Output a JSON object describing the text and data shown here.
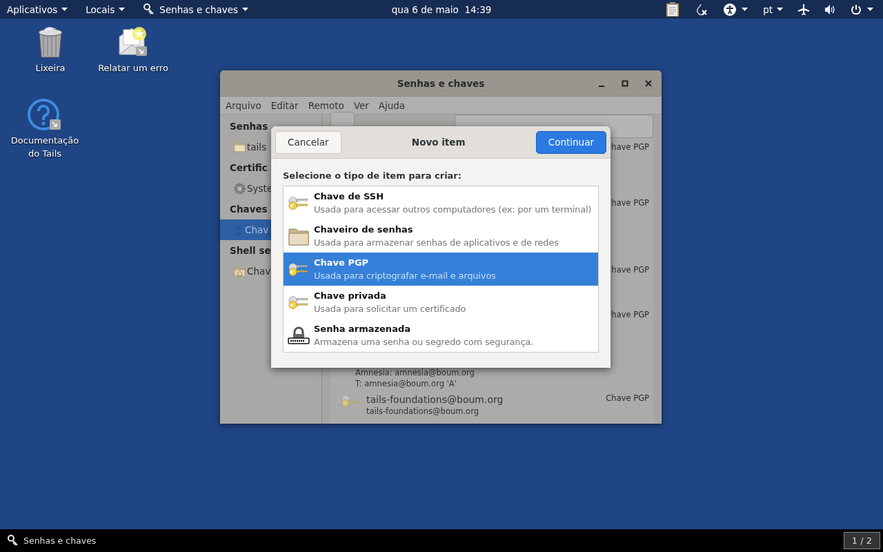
{
  "top_bar": {
    "menus": [
      {
        "label": "Aplicativos"
      },
      {
        "label": "Locais"
      },
      {
        "label": "Senhas e chaves"
      }
    ],
    "clock": "qua 6 de maio  14:39",
    "language": "pt"
  },
  "desktop_icons": [
    {
      "kind": "trash",
      "lines": [
        "Lixeira"
      ]
    },
    {
      "kind": "report",
      "lines": [
        "Relatar um erro"
      ]
    },
    {
      "kind": "help",
      "lines": [
        "Documentação",
        "do Tails"
      ]
    }
  ],
  "window": {
    "title": "Senhas e chaves",
    "menu": [
      "Arquivo",
      "Editar",
      "Remoto",
      "Ver",
      "Ajuda"
    ],
    "sidebar": [
      {
        "kind": "heading",
        "label": "Senhas"
      },
      {
        "kind": "item",
        "label": "tails",
        "selected": false
      },
      {
        "kind": "heading",
        "label": "Certific"
      },
      {
        "kind": "item",
        "label": "Syste",
        "selected": false
      },
      {
        "kind": "heading",
        "label": "Chaves"
      },
      {
        "kind": "item",
        "label": "Chav",
        "selected": true
      },
      {
        "kind": "heading",
        "label": "Shell se"
      },
      {
        "kind": "item",
        "label": "Chav",
        "selected": false
      }
    ],
    "keys": [
      {
        "type": "have PGP"
      },
      {
        "type": "have PGP"
      },
      {
        "type": "have PGP"
      },
      {
        "type": "have PGP",
        "lines": [
          "Amnesia: amnesia@boum.org",
          "T: amnesia@boum.org 'A'"
        ]
      },
      {
        "type": "Chave PGP",
        "name": "tails-foundations@boum.org",
        "lines": [
          "tails-foundations@boum.org"
        ]
      }
    ]
  },
  "dialog": {
    "title": "Novo item",
    "cancel": "Cancelar",
    "confirm": "Continuar",
    "prompt": "Selecione o tipo de item para criar:",
    "options": [
      {
        "title": "Chave de SSH",
        "description": "Usada para acessar outros computadores (ex: por um terminal)",
        "selected": false
      },
      {
        "title": "Chaveiro de senhas",
        "description": "Usada para armazenar senhas de aplicativos e de redes",
        "selected": false
      },
      {
        "title": "Chave PGP",
        "description": "Usada para criptografar e-mail e arquivos",
        "selected": true
      },
      {
        "title": "Chave privada",
        "description": "Usada para solicitar um certificado",
        "selected": false
      },
      {
        "title": "Senha armazenada",
        "description": "Armazena uma senha ou segredo com segurança.",
        "selected": false
      }
    ]
  },
  "taskbar": {
    "task": "Senhas e chaves",
    "workspace": "1 / 2"
  }
}
